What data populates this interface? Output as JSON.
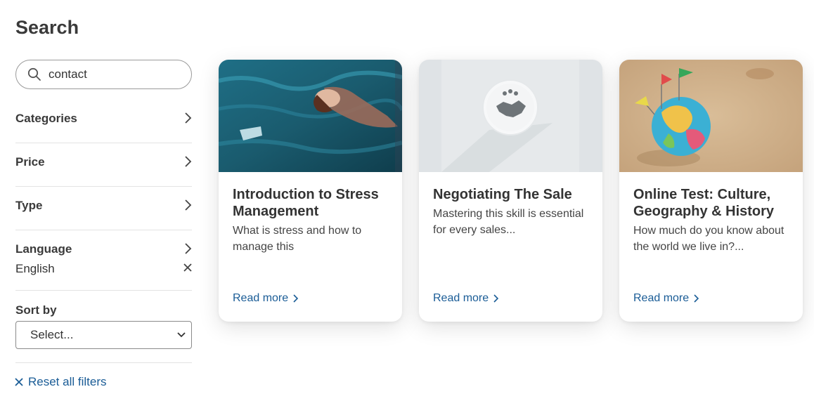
{
  "page": {
    "title": "Search"
  },
  "search": {
    "value": "contact"
  },
  "filters": {
    "categories": {
      "label": "Categories"
    },
    "price": {
      "label": "Price"
    },
    "type": {
      "label": "Type"
    },
    "language": {
      "label": "Language",
      "value": "English"
    }
  },
  "sort": {
    "label": "Sort by",
    "selected": "Select..."
  },
  "reset": {
    "label": "Reset all filters"
  },
  "cards": [
    {
      "title": "Introduction to Stress Management",
      "description": "What is stress and how to manage this",
      "link": "Read more",
      "image": "woman-floating-in-water"
    },
    {
      "title": "Negotiating The Sale",
      "description": "Mastering this skill is essential for every sales...",
      "link": "Read more",
      "image": "handshake-coins-icon"
    },
    {
      "title": "Online Test: Culture, Geography & History",
      "description": "How much do you know about the world we live in?...",
      "link": "Read more",
      "image": "globe-with-flags-on-sand"
    }
  ],
  "colors": {
    "link": "#1a5c96",
    "text": "#333333"
  }
}
